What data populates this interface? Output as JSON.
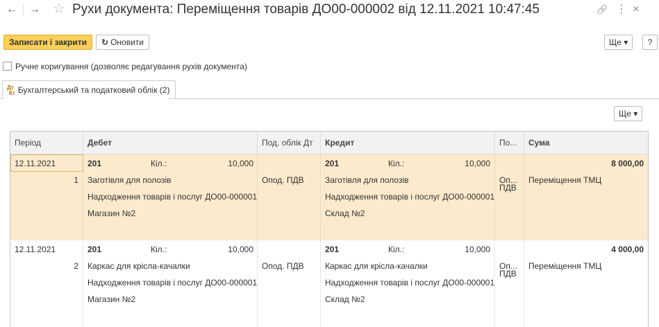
{
  "window": {
    "title": "Рухи документа: Переміщення товарів ДО00-000002 від 12.11.2021 10:47:45",
    "back_glyph": "←",
    "forward_glyph": "→",
    "star_glyph": "☆",
    "link_glyph": "🔗",
    "more_glyph": "⋮",
    "close_glyph": "×"
  },
  "toolbar": {
    "save_close_label": "Записати і закрити",
    "refresh_label": "Оновити",
    "refresh_glyph": "↻",
    "more_label": "Ще ▾",
    "help_label": "?"
  },
  "manual_edit": {
    "label": "Ручне коригування (дозволяє редагування рухів документа)",
    "checked": false
  },
  "tabs": [
    {
      "label": "Бухгалтерський та податковий облік (2)",
      "icon_top": "Дт",
      "icon_bottom": "Кт",
      "active": true
    }
  ],
  "grid": {
    "more_label": "Ще ▾",
    "columns": {
      "period": "Період",
      "debit": "Дебет",
      "tax_dt": "Под. облік Дт",
      "credit": "Кредит",
      "po": "По...",
      "sum": "Сума"
    },
    "rows": [
      {
        "period": "12.11.2021",
        "num": "1",
        "dt_account": "201",
        "dt_qty_label": "Кіл.:",
        "dt_qty": "10,000",
        "dt_sub1": "Заготівля для полозів",
        "dt_sub2": "Надходження товарів і послуг ДО00-000001...",
        "dt_sub3": "Магазин №2",
        "tax_dt": "Опод. ПДВ",
        "kt_account": "201",
        "kt_qty_label": "Кіл.:",
        "kt_qty": "10,000",
        "kt_sub1": "Заготівля для полозів",
        "kt_sub2": "Надходження товарів і послуг ДО00-000001...",
        "kt_sub3": "Склад №2",
        "po_1": "Оп...",
        "po_2": "ПДВ",
        "amount": "8 000,00",
        "content": "Переміщення ТМЦ",
        "selected": true
      },
      {
        "period": "12.11.2021",
        "num": "2",
        "dt_account": "201",
        "dt_qty_label": "Кіл.:",
        "dt_qty": "10,000",
        "dt_sub1": "Каркас для крісла-качалки",
        "dt_sub2": "Надходження товарів і послуг ДО00-000001...",
        "dt_sub3": "Магазин №2",
        "tax_dt": "Опод. ПДВ",
        "kt_account": "201",
        "kt_qty_label": "Кіл.:",
        "kt_qty": "10,000",
        "kt_sub1": "Каркас для крісла-качалки",
        "kt_sub2": "Надходження товарів і послуг ДО00-000001...",
        "kt_sub3": "Склад №2",
        "po_1": "Оп...",
        "po_2": "ПДВ",
        "amount": "4 000,00",
        "content": "Переміщення ТМЦ",
        "selected": false
      }
    ]
  }
}
